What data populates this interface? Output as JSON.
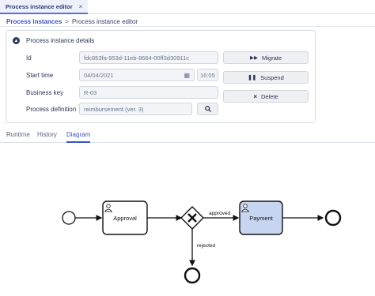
{
  "tab": {
    "label": "Process instance editor",
    "close": "×"
  },
  "breadcrumb": {
    "root": "Process instances",
    "separator": ">",
    "current": "Process instance editor"
  },
  "details": {
    "title": "Process instance details",
    "toggle_icon": "chevron-up-icon",
    "fields": {
      "id": {
        "label": "Id",
        "value": "fdc853fa-953d-11eb-8664-00ff3d30911c"
      },
      "start_time": {
        "label": "Start time",
        "date": "04/04/2021",
        "time": "16:05"
      },
      "business_key": {
        "label": "Business key",
        "value": "R-03"
      },
      "process_definition": {
        "label": "Process definition",
        "value": "reimbursement (ver. 3)"
      }
    },
    "actions": {
      "migrate": {
        "label": "Migrate",
        "icon": "fast-forward-icon"
      },
      "suspend": {
        "label": "Suspend",
        "icon": "pause-icon"
      },
      "delete": {
        "label": "Delete",
        "icon": "close-icon"
      }
    }
  },
  "subtabs": {
    "runtime": "Runtime",
    "history": "History",
    "diagram": "Diagram",
    "active": "Diagram"
  },
  "diagram": {
    "task_approval": "Approval",
    "task_payment": "Payment",
    "flow_approved": "approved",
    "flow_rejected": "rejected",
    "colors": {
      "active_task_fill": "#c8d5f0",
      "stroke": "#111111"
    }
  }
}
